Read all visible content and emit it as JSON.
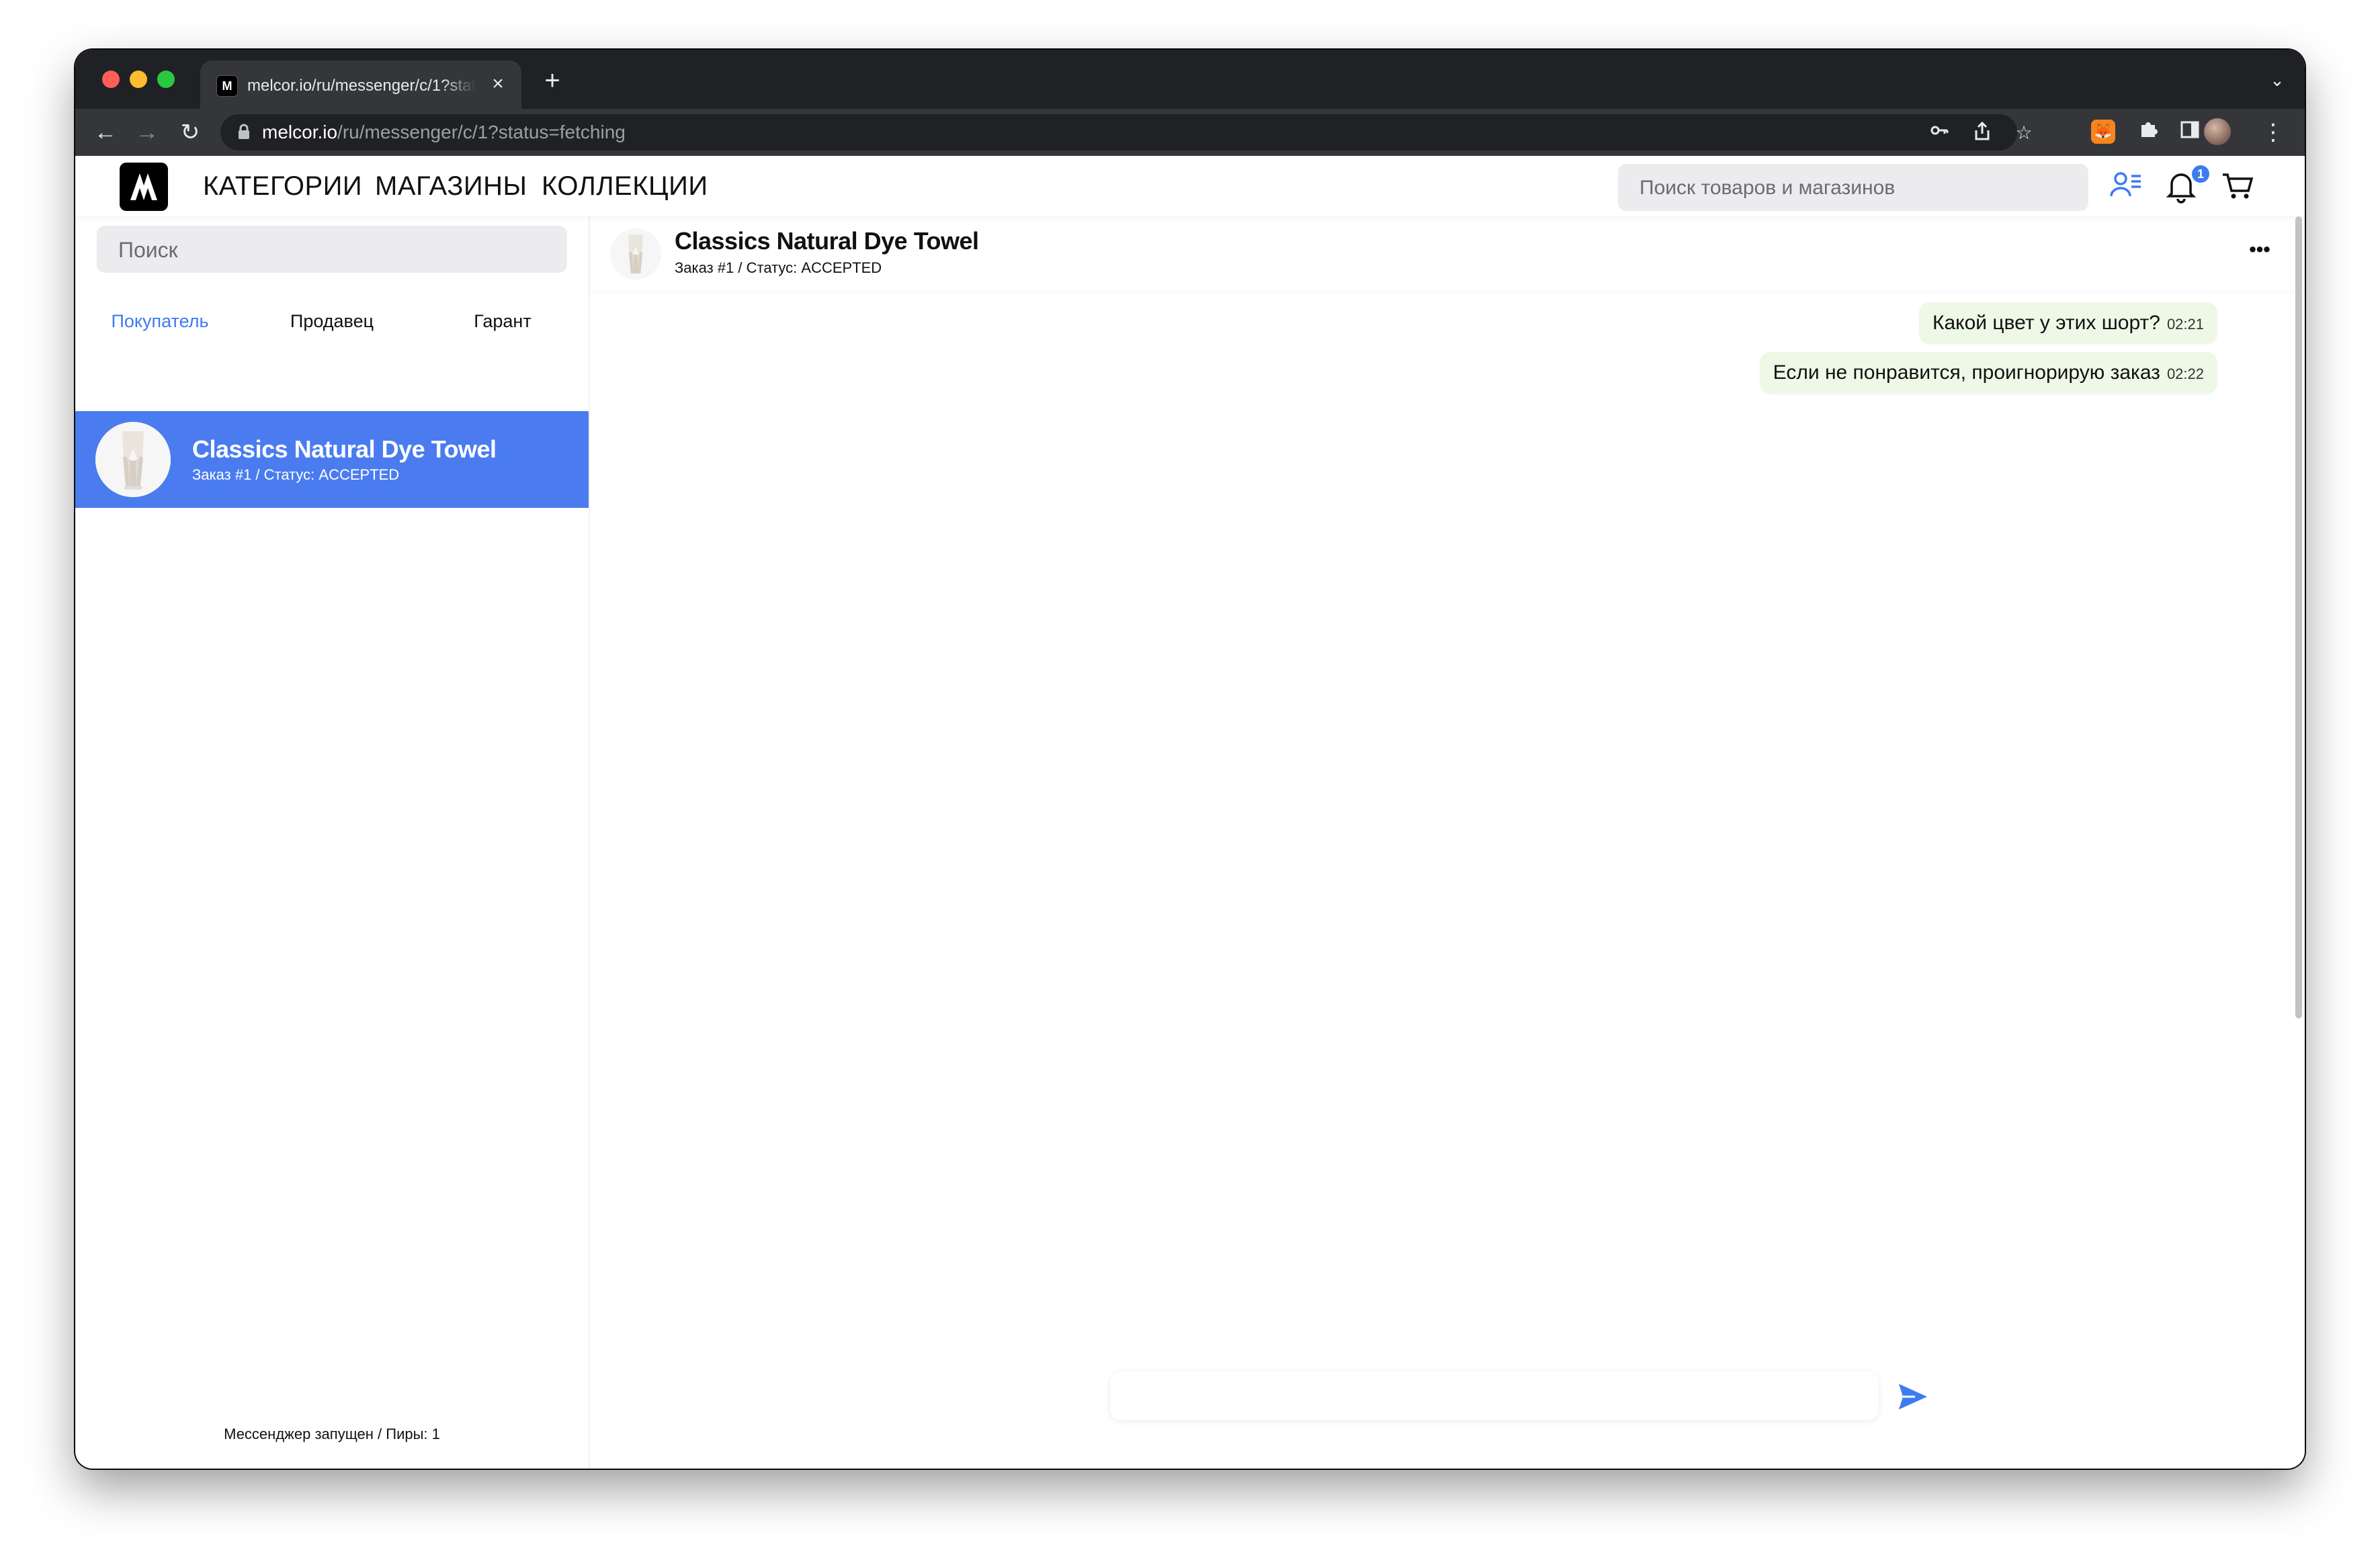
{
  "browser": {
    "tab_title": "melcor.io/ru/messenger/c/1?status=fetching",
    "tab_favicon": "melcor-logo-icon",
    "url_host": "melcor.io",
    "url_path": "/ru/messenger/c/1?status=fetching"
  },
  "site": {
    "nav": [
      "КАТЕГОРИИ",
      "МАГАЗИНЫ",
      "КОЛЛЕКЦИИ"
    ],
    "search_placeholder": "Поиск товаров и магазинов",
    "notification_count": "1",
    "accent_color": "#3d7bf0"
  },
  "sidebar": {
    "search_placeholder": "Поиск",
    "role_tabs": [
      "Покупатель",
      "Продавец",
      "Гарант"
    ],
    "active_role": "Покупатель",
    "conversations": [
      {
        "title": "Classics Natural Dye Towel",
        "subtitle": "Заказ #1 / Статус: ACCEPTED",
        "selected": true
      }
    ],
    "footer": "Мессенджер запущен / Пиры: 1"
  },
  "chat": {
    "title": "Classics Natural Dye Towel",
    "subtitle": "Заказ #1 / Статус: ACCEPTED",
    "messages": [
      {
        "text": "Какой цвет у этих шорт?",
        "time": "02:21"
      },
      {
        "text": "Если не понравится, проигнорирую заказ",
        "time": "02:22"
      }
    ],
    "composer_placeholder": ""
  }
}
